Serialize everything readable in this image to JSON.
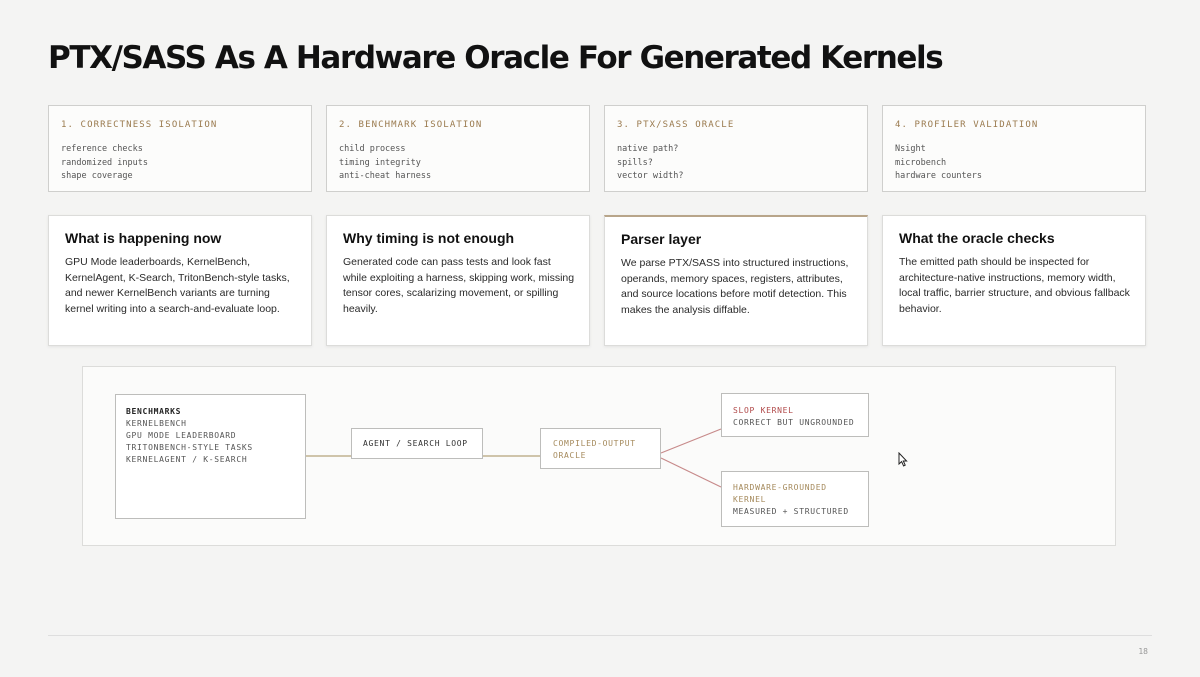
{
  "slide": {
    "title": "PTX/SASS As A Hardware Oracle For Generated Kernels",
    "page_number": "18"
  },
  "steps": [
    {
      "title": "1. CORRECTNESS ISOLATION",
      "lines": [
        "reference checks",
        "randomized inputs",
        "shape coverage"
      ]
    },
    {
      "title": "2. BENCHMARK ISOLATION",
      "lines": [
        "child process",
        "timing integrity",
        "anti-cheat harness"
      ]
    },
    {
      "title": "3. PTX/SASS ORACLE",
      "lines": [
        "native path?",
        "spills?",
        "vector width?"
      ]
    },
    {
      "title": "4. PROFILER VALIDATION",
      "lines": [
        "Nsight",
        "microbench",
        "hardware counters"
      ]
    }
  ],
  "cards": [
    {
      "title": "What is happening now",
      "body": "GPU Mode leaderboards, KernelBench, KernelAgent, K-Search, TritonBench-style tasks, and newer KernelBench variants are turning kernel writing into a search-and-evaluate loop."
    },
    {
      "title": "Why timing is not enough",
      "body": "Generated code can pass tests and look fast while exploiting a harness, skipping work, missing tensor cores, scalarizing movement, or spilling heavily."
    },
    {
      "title": "Parser layer",
      "body": "We parse PTX/SASS into structured instructions, operands, memory spaces, registers, attributes, and source locations before motif detection. This makes the analysis diffable."
    },
    {
      "title": "What the oracle checks",
      "body": "The emitted path should be inspected for architecture-native instructions, memory width, local traffic, barrier structure, and obvious fallback behavior."
    }
  ],
  "diagram": {
    "benchmarks": {
      "heading": "BENCHMARKS",
      "items": [
        "KERNELBENCH",
        "GPU MODE LEADERBOARD",
        "TRITONBENCH-STYLE TASKS",
        "KERNELAGENT / K-SEARCH"
      ]
    },
    "agent_loop": "AGENT / SEARCH LOOP",
    "compiled_output": [
      "COMPILED-OUTPUT",
      "ORACLE"
    ],
    "slop_kernel": {
      "title": "SLOP KERNEL",
      "subtitle": "CORRECT BUT UNGROUNDED"
    },
    "grounded_kernel": {
      "title_lines": [
        "HARDWARE-GROUNDED",
        "KERNEL"
      ],
      "subtitle": "MEASURED + STRUCTURED"
    }
  },
  "colors": {
    "gold": "#9a7a4e",
    "edge_gold": "#b5a27a",
    "red": "#b04848",
    "edge_red": "#c78a8a"
  }
}
